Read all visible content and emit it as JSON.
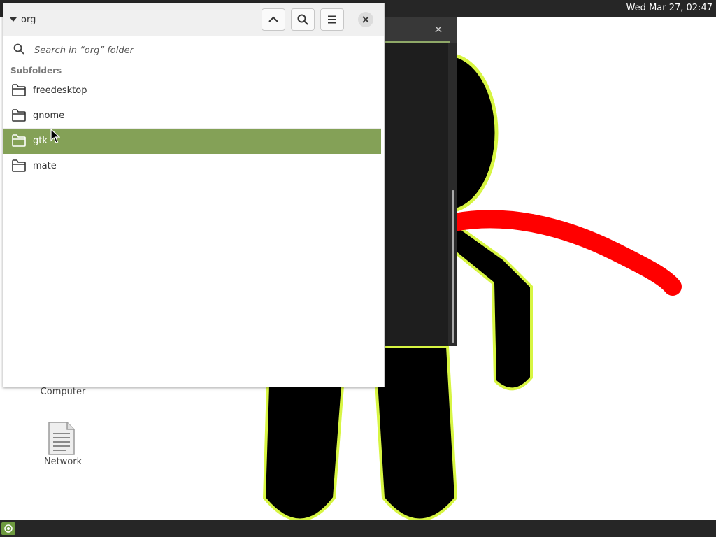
{
  "top_panel": {
    "clock": "Wed Mar 27, 02:47"
  },
  "dialog": {
    "path_label": "org",
    "search_placeholder": "Search in “org” folder",
    "subfolders_heading": "Subfolders",
    "folders": [
      {
        "name": "freedesktop",
        "selected": false
      },
      {
        "name": "gnome",
        "selected": false
      },
      {
        "name": "gtk",
        "selected": true
      },
      {
        "name": "mate",
        "selected": false
      }
    ],
    "icons": {
      "up": "chevron-up-icon",
      "search": "search-icon",
      "menu": "hamburger-menu-icon",
      "close": "close-icon",
      "folder": "folder-icon"
    }
  },
  "desktop": {
    "icons": [
      {
        "label": "Computer"
      },
      {
        "label": "Network"
      }
    ]
  },
  "background_window": {
    "close_glyph": "×"
  },
  "colors": {
    "selection": "#84a157",
    "panel": "#262626",
    "accent": "#8fa868"
  }
}
